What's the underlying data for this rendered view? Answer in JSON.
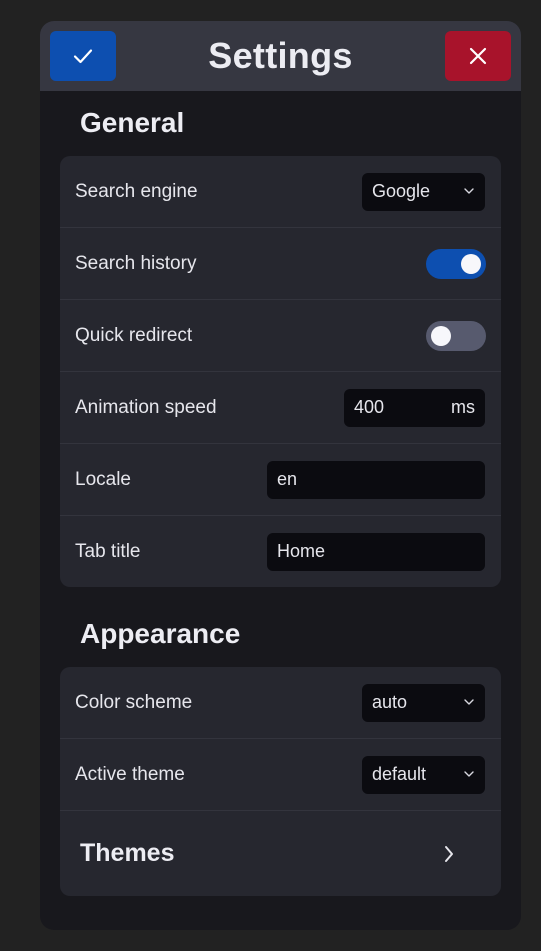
{
  "header": {
    "title": "Settings",
    "confirm_icon": "check-icon",
    "close_icon": "close-icon",
    "confirm_color": "#0d4fb0",
    "close_color": "#a8132b"
  },
  "general": {
    "heading": "General",
    "search_engine": {
      "label": "Search engine",
      "value": "Google"
    },
    "search_history": {
      "label": "Search history",
      "enabled": true
    },
    "quick_redirect": {
      "label": "Quick redirect",
      "enabled": false
    },
    "animation_speed": {
      "label": "Animation speed",
      "value": "400",
      "unit": "ms"
    },
    "locale": {
      "label": "Locale",
      "value": "en"
    },
    "tab_title": {
      "label": "Tab title",
      "value": "Home"
    }
  },
  "appearance": {
    "heading": "Appearance",
    "color_scheme": {
      "label": "Color scheme",
      "value": "auto"
    },
    "active_theme": {
      "label": "Active theme",
      "value": "default"
    },
    "themes": {
      "label": "Themes",
      "icon": "chevron-right-icon"
    }
  }
}
